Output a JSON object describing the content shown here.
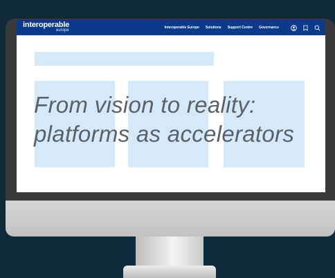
{
  "brand": {
    "name": "interoperable",
    "sub": "europe"
  },
  "nav": {
    "links": [
      "Interoperable Europe",
      "Solutions",
      "Support Centre",
      "Governance"
    ],
    "icons": [
      "user-icon",
      "bookmark-icon",
      "search-icon"
    ]
  },
  "hero": {
    "headline_line1": "From vision to reality:",
    "headline_line2": "platforms as accelerators"
  },
  "colors": {
    "navbar": "#0b3a8d",
    "placeholder": "#d6e9f8",
    "headline": "#5a6168",
    "background": "#0e2a3b"
  }
}
